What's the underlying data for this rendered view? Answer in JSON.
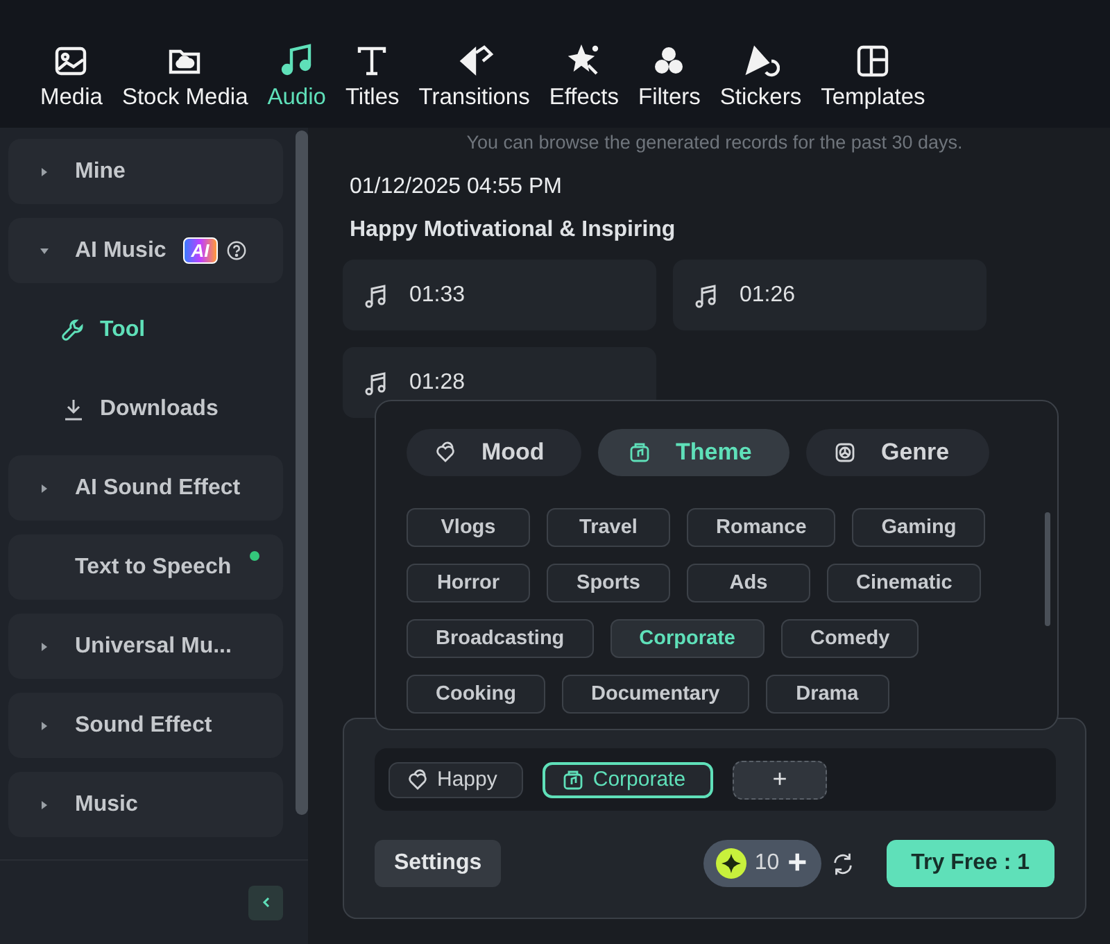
{
  "toolbar": {
    "tabs": [
      {
        "label": "Media",
        "selected": false
      },
      {
        "label": "Stock Media",
        "selected": false
      },
      {
        "label": "Audio",
        "selected": true
      },
      {
        "label": "Titles",
        "selected": false
      },
      {
        "label": "Transitions",
        "selected": false
      },
      {
        "label": "Effects",
        "selected": false
      },
      {
        "label": "Filters",
        "selected": false
      },
      {
        "label": "Stickers",
        "selected": false
      },
      {
        "label": "Templates",
        "selected": false
      }
    ]
  },
  "sidebar": {
    "items": [
      {
        "kind": "group",
        "label": "Mine",
        "expanded": false
      },
      {
        "kind": "group",
        "label": "AI Music",
        "expanded": true,
        "badge": "AI",
        "help": true
      },
      {
        "kind": "tool",
        "label": "Tool",
        "selected": true
      },
      {
        "kind": "download",
        "label": "Downloads",
        "selected": false
      },
      {
        "kind": "group",
        "label": "AI Sound Effect",
        "expanded": false
      },
      {
        "kind": "plain",
        "label": "Text to Speech",
        "new_dot": true
      },
      {
        "kind": "group",
        "label": "Universal Mu...",
        "expanded": false
      },
      {
        "kind": "group",
        "label": "Sound Effect",
        "expanded": false
      },
      {
        "kind": "group",
        "label": "Music",
        "expanded": false
      }
    ]
  },
  "main": {
    "note": "You can browse the generated records for the past 30 days.",
    "record": {
      "date": "01/12/2025 04:55 PM",
      "title": "Happy Motivational & Inspiring",
      "tracks": [
        {
          "duration": "01:33"
        },
        {
          "duration": "01:26"
        },
        {
          "duration": "01:28"
        }
      ]
    }
  },
  "popup": {
    "tabs": [
      {
        "label": "Mood",
        "selected": false
      },
      {
        "label": "Theme",
        "selected": true
      },
      {
        "label": "Genre",
        "selected": false
      }
    ],
    "tags": [
      {
        "label": "Vlogs",
        "selected": false
      },
      {
        "label": "Travel",
        "selected": false
      },
      {
        "label": "Romance",
        "selected": false
      },
      {
        "label": "Gaming",
        "selected": false
      },
      {
        "label": "Horror",
        "selected": false
      },
      {
        "label": "Sports",
        "selected": false
      },
      {
        "label": "Ads",
        "selected": false
      },
      {
        "label": "Cinematic",
        "selected": false
      },
      {
        "label": "Broadcasting",
        "selected": false
      },
      {
        "label": "Corporate",
        "selected": true
      },
      {
        "label": "Comedy",
        "selected": false
      },
      {
        "label": "Cooking",
        "selected": false
      },
      {
        "label": "Documentary",
        "selected": false
      },
      {
        "label": "Drama",
        "selected": false
      }
    ]
  },
  "prompt": {
    "chips": [
      {
        "kind": "mood",
        "label": "Happy",
        "selected": false
      },
      {
        "kind": "theme",
        "label": "Corporate",
        "selected": true
      }
    ],
    "add_button": "+",
    "settings_button": "Settings",
    "credits": "10",
    "credits_add": "+",
    "try_button": "Try Free : 1"
  }
}
